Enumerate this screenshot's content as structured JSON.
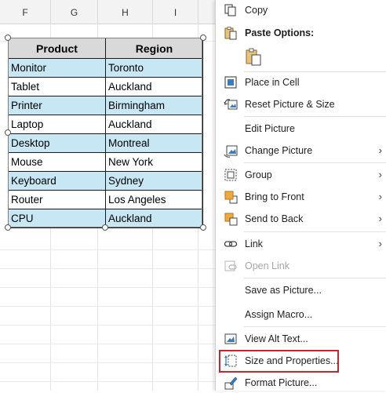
{
  "sheet": {
    "column_headers": [
      "F",
      "G",
      "H",
      "I"
    ],
    "table": {
      "headers": [
        "Product",
        "Region"
      ],
      "rows": [
        [
          "Monitor",
          "Toronto"
        ],
        [
          "Tablet",
          "Auckland"
        ],
        [
          "Printer",
          "Birmingham"
        ],
        [
          "Laptop",
          "Auckland"
        ],
        [
          "Desktop",
          "Montreal"
        ],
        [
          "Mouse",
          "New York"
        ],
        [
          "Keyboard",
          "Sydney"
        ],
        [
          "Router",
          "Los Angeles"
        ],
        [
          "CPU",
          "Auckland"
        ]
      ]
    },
    "colors": {
      "band": "#c6e7f3",
      "header": "#d9d9d9"
    }
  },
  "context_menu": {
    "copy": "Copy",
    "paste_options": "Paste Options:",
    "place_in_cell": "Place in Cell",
    "reset_picture_size": "Reset Picture & Size",
    "edit_picture": "Edit Picture",
    "change_picture": "Change Picture",
    "group": "Group",
    "bring_to_front": "Bring to Front",
    "send_to_back": "Send to Back",
    "link": "Link",
    "open_link": "Open Link",
    "save_as_picture": "Save as Picture...",
    "assign_macro": "Assign Macro...",
    "view_alt_text": "View Alt Text...",
    "size_and_properties": "Size and Properties...",
    "format_picture": "Format Picture...",
    "submenu_arrow": "›",
    "highlight_color": "#c4262e"
  }
}
